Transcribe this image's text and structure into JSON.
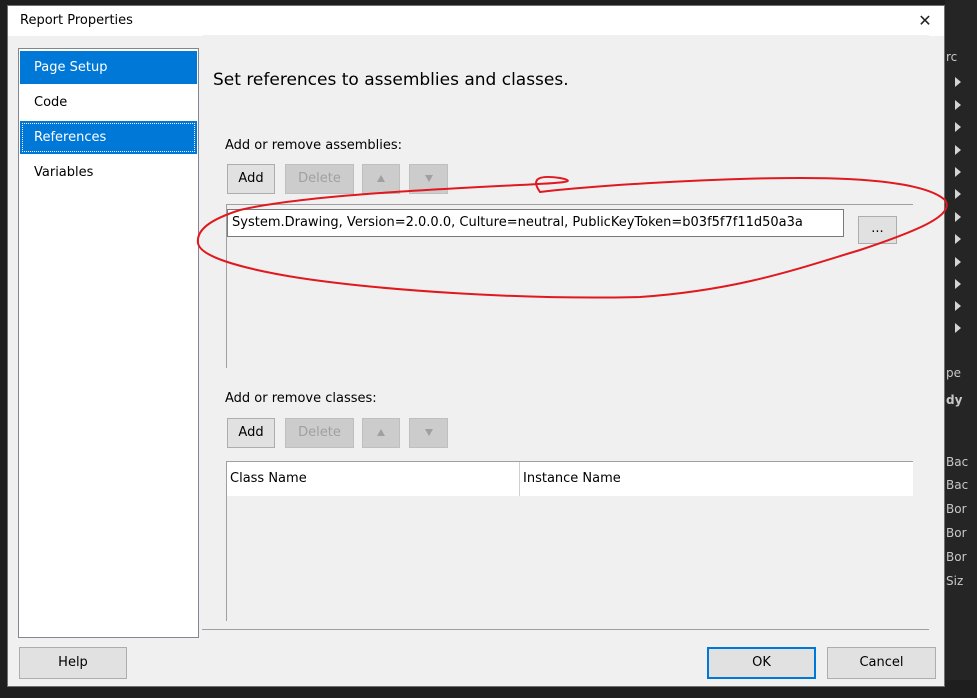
{
  "dialog": {
    "title": "Report Properties",
    "close_glyph": "✕"
  },
  "nav": {
    "items": [
      {
        "label": "Page Setup"
      },
      {
        "label": "Code"
      },
      {
        "label": "References"
      },
      {
        "label": "Variables"
      }
    ],
    "selected": "References"
  },
  "main": {
    "heading": "Set references to assemblies and classes.",
    "assemblies": {
      "label": "Add or remove assemblies:",
      "add_label": "Add",
      "delete_label": "Delete",
      "entry_value": "System.Drawing, Version=2.0.0.0, Culture=neutral, PublicKeyToken=b03f5f7f11d50a3a",
      "browse_label": "..."
    },
    "classes": {
      "label": "Add or remove classes:",
      "add_label": "Add",
      "delete_label": "Delete",
      "columns": [
        "Class Name",
        "Instance Name"
      ]
    }
  },
  "footer": {
    "help_label": "Help",
    "ok_label": "OK",
    "cancel_label": "Cancel"
  },
  "background_ide": {
    "right_fragments": [
      "rc",
      "pe",
      "dy",
      "Bac",
      "Bac",
      "Bor",
      "Bor",
      "Bor",
      "Siz"
    ]
  },
  "colors": {
    "selection": "#0078d7",
    "annotation": "#e0191f"
  }
}
